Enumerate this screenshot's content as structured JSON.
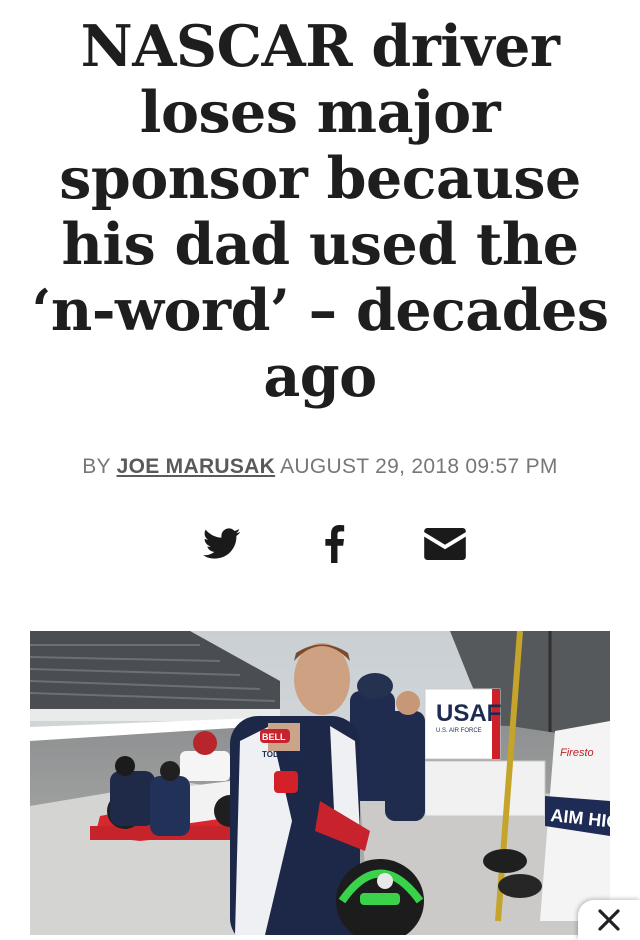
{
  "article": {
    "headline": "NASCAR driver loses major sponsor because his dad used the ‘n-word’ – decades ago",
    "byline_prefix": "BY",
    "author": "JOE MARUSAK",
    "timestamp": "AUGUST 29, 2018 09:57 PM"
  },
  "share": {
    "icons": [
      "twitter-icon",
      "facebook-icon",
      "email-icon"
    ]
  },
  "photo": {
    "sign_text": "USAF",
    "sign_subtext": "U.S. AIR FORCE",
    "banner_text": "AIM HIG",
    "badge_text": "BELL",
    "patch_text": "TODD LANG",
    "firestone_text": "Firesto"
  },
  "overlay": {
    "close_icon": "close-icon"
  },
  "colors": {
    "headline": "#1e1e1e",
    "byline": "#777777",
    "icons": "#1a1a1a"
  }
}
